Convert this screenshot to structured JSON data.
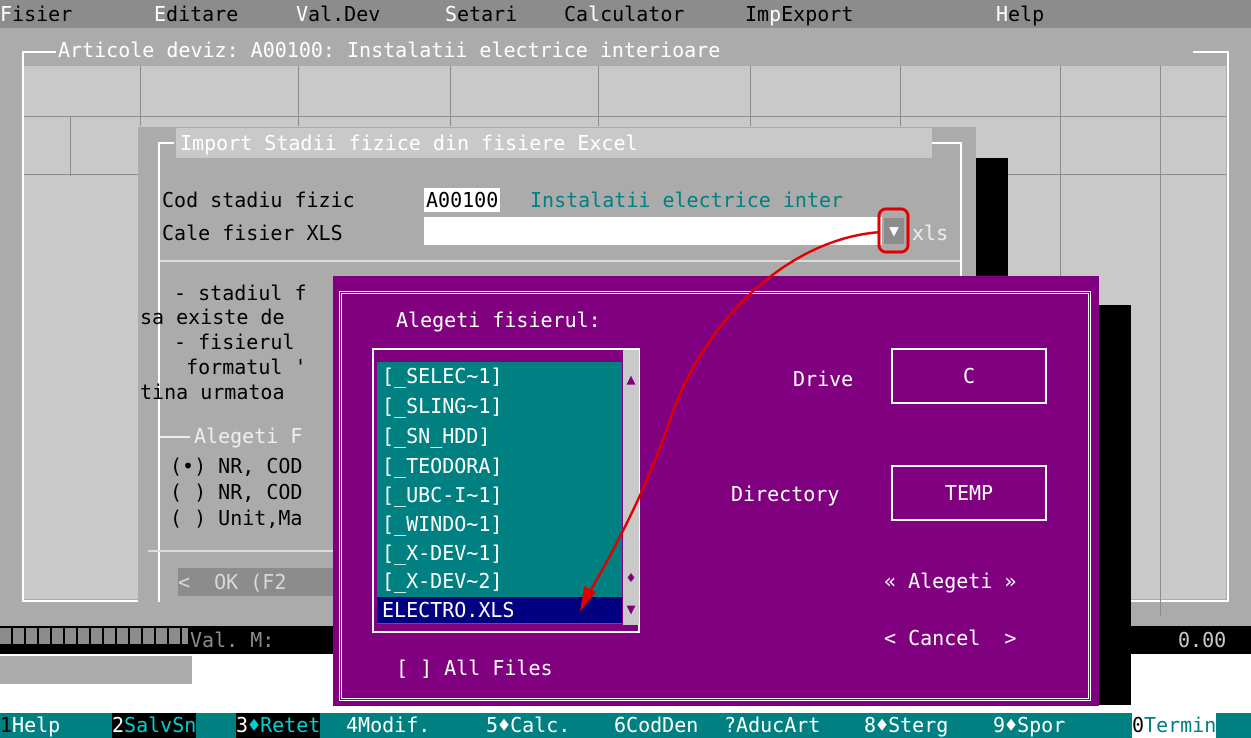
{
  "menu": {
    "items": [
      {
        "hotkey": "F",
        "rest": "isier"
      },
      {
        "hotkey": "E",
        "rest": "ditare"
      },
      {
        "hotkey": "V",
        "rest": "al.Dev"
      },
      {
        "hotkey": "S",
        "rest": "etari"
      },
      {
        "pre": "Ca",
        "hotkey": "l",
        "rest": "culator"
      },
      {
        "pre": "Im",
        "hotkey": "p",
        "rest": "Export"
      },
      {
        "hotkey": "H",
        "rest": "elp"
      }
    ]
  },
  "main_window": {
    "title": "Articole deviz: A00100: Instalatii electrice interioare"
  },
  "import_dialog": {
    "title": "Import Stadii fizice din fisiere Excel",
    "cod_label": "Cod stadiu fizic",
    "cod_value": "A00100",
    "cod_name": "Instalatii electrice inter",
    "cale_label": "Cale fisier XLS",
    "cale_value": "",
    "dropdown_glyph": "▼",
    "ext_label": "xls",
    "info_lines": [
      " - stadiul f",
      "sa existe de",
      " - fisierul ",
      "  formatul '",
      "tina urmatoa"
    ],
    "group_label": "Alegeti F",
    "radios": [
      "(•) NR, COD",
      "( ) NR, COD",
      "( ) Unit,Ma"
    ],
    "ok_button": "<  OK (F2"
  },
  "file_dialog": {
    "title": "Alegeti fisierul:",
    "files": [
      "[_SELEC~1]",
      "[_SLING~1]",
      "[_SN_HDD]",
      "[_TEODORA]",
      "[_UBC-I~1]",
      "[_WINDO~1]",
      "[_X-DEV~1]",
      "[_X-DEV~2]"
    ],
    "selected_file": "ELECTRO.XLS",
    "drive_label": "Drive",
    "drive_value": "C",
    "directory_label": "Directory",
    "directory_value": "TEMP",
    "choose_button": "« Alegeti »",
    "cancel_button": "< Cancel  >",
    "all_files_checkbox": "[ ] All Files",
    "scroll_up_glyph": "▲",
    "scroll_thumb_glyph": "♦",
    "scroll_down_glyph": "▼"
  },
  "status": {
    "val_label": "Val. M:",
    "val_right": "0.00"
  },
  "fkeys": [
    {
      "num": "1",
      "label": "Help"
    },
    {
      "num": "2",
      "label": "SalvSn"
    },
    {
      "num": "3",
      "label": "♦Retet"
    },
    {
      "num": "4",
      "label": "Modif."
    },
    {
      "num": "5",
      "label": "♦Calc."
    },
    {
      "num": "6",
      "label": "CodDen"
    },
    {
      "num": "?",
      "label": "AducArt"
    },
    {
      "num": "8",
      "label": "♦Sterg"
    },
    {
      "num": "9",
      "label": "♦Spor"
    },
    {
      "num": "0",
      "label": "Termin"
    }
  ],
  "annotation": {
    "color": "#e00000"
  }
}
